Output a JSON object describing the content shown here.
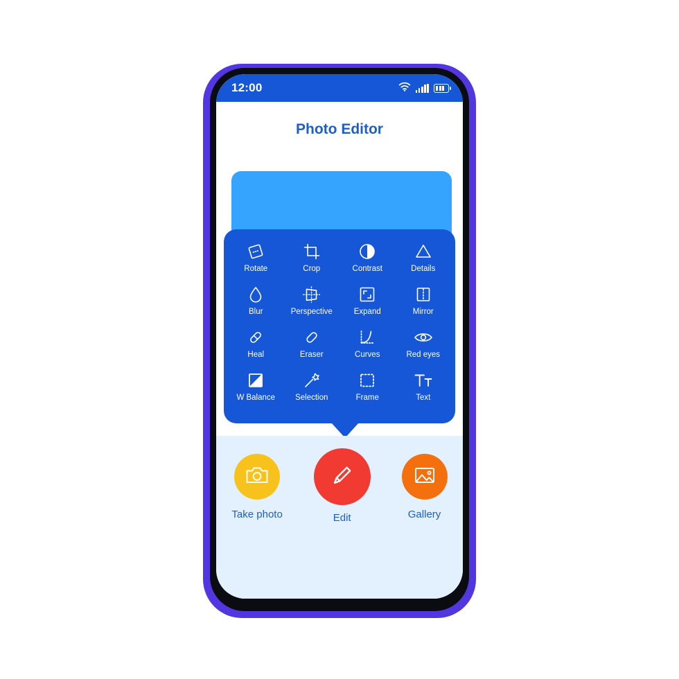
{
  "app": {
    "title": "Photo Editor"
  },
  "status_bar": {
    "time": "12:00",
    "wifi_icon": "wifi-icon",
    "signal_icon": "signal-bars-icon",
    "battery_icon": "battery-icon",
    "battery_bars": 3
  },
  "preview": {
    "name": "photo-preview-placeholder",
    "color": "#35a4ff"
  },
  "tool_panel": {
    "background": "#1557d6",
    "tools": [
      {
        "label": "Rotate",
        "icon": "rotate-icon"
      },
      {
        "label": "Crop",
        "icon": "crop-icon"
      },
      {
        "label": "Contrast",
        "icon": "contrast-icon"
      },
      {
        "label": "Details",
        "icon": "details-triangle-icon"
      },
      {
        "label": "Blur",
        "icon": "blur-droplet-icon"
      },
      {
        "label": "Perspective",
        "icon": "perspective-icon"
      },
      {
        "label": "Expand",
        "icon": "expand-icon"
      },
      {
        "label": "Mirror",
        "icon": "mirror-icon"
      },
      {
        "label": "Heal",
        "icon": "heal-bandage-icon"
      },
      {
        "label": "Eraser",
        "icon": "eraser-icon"
      },
      {
        "label": "Curves",
        "icon": "curves-icon"
      },
      {
        "label": "Red eyes",
        "icon": "red-eyes-icon"
      },
      {
        "label": "W Balance",
        "icon": "white-balance-icon"
      },
      {
        "label": "Selection",
        "icon": "magic-wand-icon"
      },
      {
        "label": "Frame",
        "icon": "frame-dashed-icon"
      },
      {
        "label": "Text",
        "icon": "text-icon"
      }
    ]
  },
  "bottom_bar": {
    "background": "#e3f0fd",
    "actions": [
      {
        "label": "Take photo",
        "icon": "camera-icon",
        "color": "#f7c21b"
      },
      {
        "label": "Edit",
        "icon": "pencil-icon",
        "color": "#f03a32"
      },
      {
        "label": "Gallery",
        "icon": "gallery-icon",
        "color": "#f4700f"
      }
    ]
  },
  "theme": {
    "frame_purple": "#5237e0",
    "bezel_black": "#0b0b12",
    "primary_blue": "#1557d6",
    "title_blue": "#1f5fc4"
  }
}
